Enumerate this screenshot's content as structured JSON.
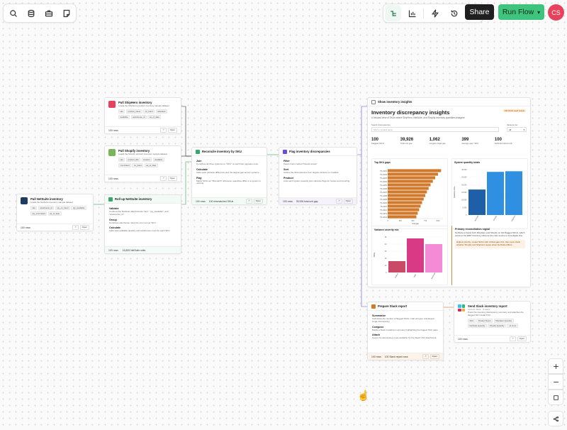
{
  "top_left_tools": [
    "search-icon",
    "database-icon",
    "toolbox-icon",
    "note-icon"
  ],
  "top_right": {
    "share": "Share",
    "run_flow": "Run Flow",
    "avatar": "CS"
  },
  "nodes": {
    "shiphero": {
      "title": "Pull ShipHero inventory",
      "desc": "Loads the ShipHero product inventory sample dataset",
      "chips": [
        "sku",
        "product_name",
        "on_hand",
        "allocated",
        "available",
        "warehouse_id",
        "as_of_date"
      ],
      "rows": "100 rows",
      "open": "Open"
    },
    "shopify": {
      "title": "Pull Shopify inventory",
      "desc": "Loads the Shopify product inventory sample dataset",
      "chips": [
        "sku",
        "product_title",
        "location",
        "available",
        "committed",
        "on_hand",
        "as_of_date"
      ],
      "rows": "100 rows",
      "open": "Open"
    },
    "netsuite": {
      "title": "Pull NetSuite inventory",
      "desc": "Loads the NetSuite inventory sample dataset",
      "chips": [
        "sku",
        "warehouse_id",
        "qty_on_hand",
        "qty_available",
        "qty_committed",
        "as_of_date"
      ],
      "rows": "100 rows",
      "open": "Open"
    },
    "rollup": {
      "title": "Roll up NetSuite inventory",
      "steps": [
        {
          "t": "Validate",
          "d": "Confirms the NetSuite data includes \"sku\", \"qty_available\", and \"warehouse_id\"."
        },
        {
          "t": "Group",
          "d": "Combines warehouse rows into one row per SKU."
        },
        {
          "t": "Calculate",
          "d": "Adds total available quantity and warehouse count for each SKU."
        }
      ],
      "rows": "100 rows",
      "extra": "16,825 NetSuite units"
    },
    "reconcile": {
      "title": "Reconcile inventory by SKU",
      "steps": [
        {
          "t": "Join",
          "d": "Combines all three systems on \"SKU\" so each item appears once."
        },
        {
          "t": "Calculate",
          "d": "Adds each pairwise difference plus the largest gap across systems."
        },
        {
          "t": "Flag",
          "d": "Marks SKUs as \"Mismatch\" whenever quantities differ or a system is missing."
        }
      ],
      "rows": "100 rows",
      "extra": "100 mismatched SKUs",
      "open": "Open"
    },
    "flag": {
      "title": "Flag inventory discrepancies",
      "steps": [
        {
          "t": "Filter",
          "d": "Keeps rows marked \"Needs review\"."
        },
        {
          "t": "Sort",
          "d": "Orders the discrepancies from largest variance to smallest."
        },
        {
          "t": "Produce",
          "d": "Lists each system quantity plus variance flags for review and reporting."
        }
      ],
      "rows": "100 rows",
      "extra": "39,926 total unit gap",
      "open": "Open"
    },
    "slack": {
      "title": "Prepare Slack report",
      "steps": [
        {
          "t": "Summarize",
          "d": "Calculates the number of flagged SKUs, total unit gap, and largest single discrepancy."
        },
        {
          "t": "Compose",
          "d": "Builds a Slack markdown summary highlighting the biggest SKU gaps."
        },
        {
          "t": "Attach",
          "d": "Keeps the discrepancy rows available for the Slack CSV attachment."
        }
      ],
      "rows": "100 rows",
      "extra": "100 Slack report rows",
      "open": "Open"
    },
    "send": {
      "title": "Send Slack inventory report",
      "sub": "Account: Slack · Timeline",
      "desc": "Posts the inventory discrepancy summary and attaches the flagged SKU detail CSV.",
      "chips": [
        "SKU",
        "Product Name",
        "ShipHero Quantity",
        "NetSuite Quantity",
        "Shopify Quantity",
        "+6 more"
      ],
      "rows": "100 rows",
      "open": "Open"
    }
  },
  "dashboard": {
    "header": "Show inventory insights",
    "title": "Inventory discrepancy insights",
    "subtitle": "A focused view of SKUs where ShipHero, NetSuite, and Shopify inventory quantities disagree.",
    "badge": "100 SKUs need review",
    "search_label": "Search discrepancies",
    "search_placeholder": "SKU or product name",
    "variance_label": "Variance tier",
    "variance_value": "All",
    "kpis": [
      {
        "v": "100",
        "l": "Flagged SKUs"
      },
      {
        "v": "39,926",
        "l": "Total unit gap"
      },
      {
        "v": "1,062",
        "l": "Largest single gap"
      },
      {
        "v": "399",
        "l": "Average gap / SKU"
      },
      {
        "v": "100",
        "l": "NetSuite below both"
      }
    ],
    "gaps_title": "Top SKU gaps",
    "gaps_xlabel": "Unit gap",
    "totals_title": "System quantity totals",
    "totals_ylabel": "Quantity units",
    "severity_title": "Variance severity mix",
    "severity_ylabel": "SKUs",
    "signal_title": "Primary reconciliation signal",
    "signal_text": "NetSuite is below both ShipHero and Shopify on 100 flagged SKUs, which points to the ERP inventory rollup as the main source to investigate first.",
    "signal_note": "Highest priority: review SKUs with critical gaps first, then spot check whether Shopify and ShipHero agree when NetSuite differs."
  },
  "chart_data": [
    {
      "type": "bar",
      "orientation": "horizontal",
      "title": "Top SKU gaps",
      "xlabel": "Unit gap",
      "categories": [
        "TS-1001",
        "TS-1002",
        "TS-1003",
        "TS-1004",
        "TS-1005",
        "TS-1006",
        "TS-1007",
        "TS-1008",
        "TS-1009",
        "TS-1010",
        "TS-1011",
        "TS-1012",
        "TS-1013",
        "TS-1014"
      ],
      "values": [
        1062,
        1001,
        945,
        898,
        853,
        815,
        780,
        748,
        716,
        685,
        655,
        626,
        598,
        571
      ],
      "xlim": [
        0,
        1100
      ],
      "color": "#d27a2c"
    },
    {
      "type": "bar",
      "title": "System quantity totals",
      "ylabel": "Quantity units",
      "categories": [
        "NetSuite",
        "Shopify",
        "ShipHero"
      ],
      "values": [
        16825,
        28500,
        28900
      ],
      "ylim": [
        0,
        30000
      ],
      "colors": [
        "#1f5fa8",
        "#2f8fe0",
        "#2f8fe0"
      ]
    },
    {
      "type": "bar",
      "title": "Variance severity mix",
      "ylabel": "SKUs",
      "categories": [
        "Critical",
        "High",
        "Moderate"
      ],
      "values": [
        16,
        48,
        40
      ],
      "ylim": [
        0,
        50
      ],
      "colors": [
        "#c94966",
        "#d93a86",
        "#f58ad6"
      ]
    }
  ],
  "colors": {
    "run_flow": "#3ec47d",
    "share": "#1f1f1f",
    "avatar": "#e8415c"
  }
}
